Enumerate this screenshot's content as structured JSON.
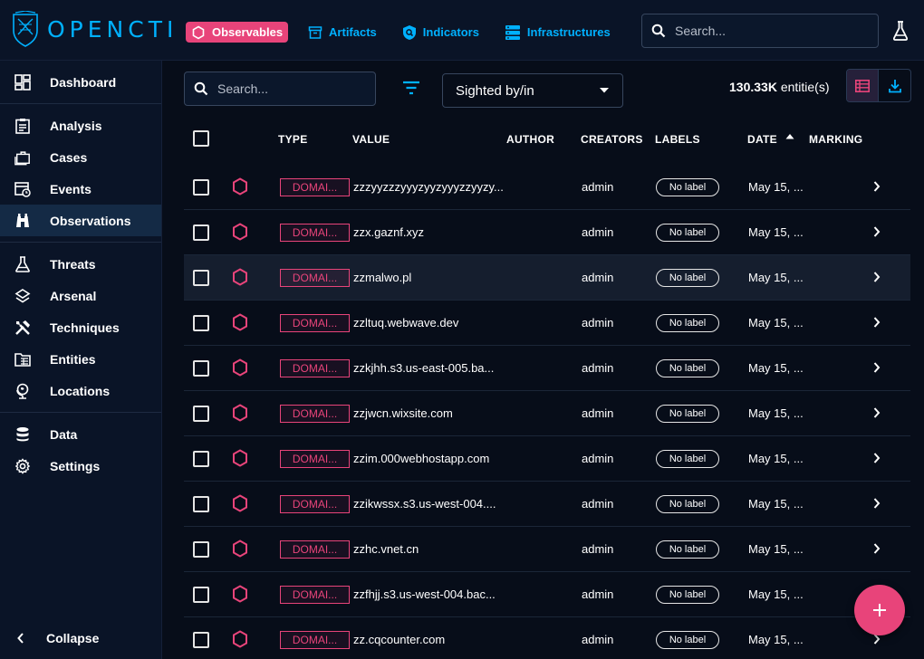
{
  "app": {
    "name": "OPENCTI"
  },
  "colors": {
    "accent_blue": "#00b1ff",
    "accent_pink": "#e8447a",
    "background": "#070d19",
    "panel": "#0a1427"
  },
  "top_nav": [
    {
      "label": "Observables",
      "icon": "hexagon-icon",
      "active": true
    },
    {
      "label": "Artifacts",
      "icon": "archive-icon",
      "active": false
    },
    {
      "label": "Indicators",
      "icon": "shield-search-icon",
      "active": false
    },
    {
      "label": "Infrastructures",
      "icon": "server-icon",
      "active": false
    }
  ],
  "search": {
    "placeholder": "Search..."
  },
  "sidebar": {
    "groups": [
      [
        {
          "label": "Dashboard",
          "icon": "dashboard-icon"
        }
      ],
      [
        {
          "label": "Analysis",
          "icon": "clipboard-icon"
        },
        {
          "label": "Cases",
          "icon": "briefcase-icon"
        },
        {
          "label": "Events",
          "icon": "calendar-clock-icon"
        },
        {
          "label": "Observations",
          "icon": "binoculars-icon",
          "active": true
        }
      ],
      [
        {
          "label": "Threats",
          "icon": "flask-icon"
        },
        {
          "label": "Arsenal",
          "icon": "layers-icon"
        },
        {
          "label": "Techniques",
          "icon": "tools-icon"
        },
        {
          "label": "Entities",
          "icon": "folder-table-icon"
        },
        {
          "label": "Locations",
          "icon": "globe-pin-icon"
        }
      ],
      [
        {
          "label": "Data",
          "icon": "database-icon"
        },
        {
          "label": "Settings",
          "icon": "gear-icon"
        }
      ]
    ],
    "collapse_label": "Collapse"
  },
  "list": {
    "search_placeholder": "Search...",
    "filter_select": "Sighted by/in",
    "count_value": "130.33K",
    "count_unit": " entitie(s)",
    "columns": {
      "type": "TYPE",
      "value": "VALUE",
      "author": "AUTHOR",
      "creators": "CREATORS",
      "labels": "LABELS",
      "date": "DATE",
      "marking": "MARKING"
    },
    "sort": {
      "column": "DATE",
      "direction": "ascending"
    },
    "rows": [
      {
        "type": "DOMAI...",
        "value": "zzzyyzzzyyyzyyzyyyzzyyzy...",
        "creator": "admin",
        "label": "No label",
        "date": "May 15, ..."
      },
      {
        "type": "DOMAI...",
        "value": "zzx.gaznf.xyz",
        "creator": "admin",
        "label": "No label",
        "date": "May 15, ..."
      },
      {
        "type": "DOMAI...",
        "value": "zzmalwo.pl",
        "creator": "admin",
        "label": "No label",
        "date": "May 15, ..."
      },
      {
        "type": "DOMAI...",
        "value": "zzltuq.webwave.dev",
        "creator": "admin",
        "label": "No label",
        "date": "May 15, ..."
      },
      {
        "type": "DOMAI...",
        "value": "zzkjhh.s3.us-east-005.ba...",
        "creator": "admin",
        "label": "No label",
        "date": "May 15, ..."
      },
      {
        "type": "DOMAI...",
        "value": "zzjwcn.wixsite.com",
        "creator": "admin",
        "label": "No label",
        "date": "May 15, ..."
      },
      {
        "type": "DOMAI...",
        "value": "zzim.000webhostapp.com",
        "creator": "admin",
        "label": "No label",
        "date": "May 15, ..."
      },
      {
        "type": "DOMAI...",
        "value": "zzikwssx.s3.us-west-004....",
        "creator": "admin",
        "label": "No label",
        "date": "May 15, ..."
      },
      {
        "type": "DOMAI...",
        "value": "zzhc.vnet.cn",
        "creator": "admin",
        "label": "No label",
        "date": "May 15, ..."
      },
      {
        "type": "DOMAI...",
        "value": "zzfhjj.s3.us-west-004.bac...",
        "creator": "admin",
        "label": "No label",
        "date": "May 15, ..."
      },
      {
        "type": "DOMAI...",
        "value": "zz.cqcounter.com",
        "creator": "admin",
        "label": "No label",
        "date": "May 15, ..."
      }
    ]
  }
}
